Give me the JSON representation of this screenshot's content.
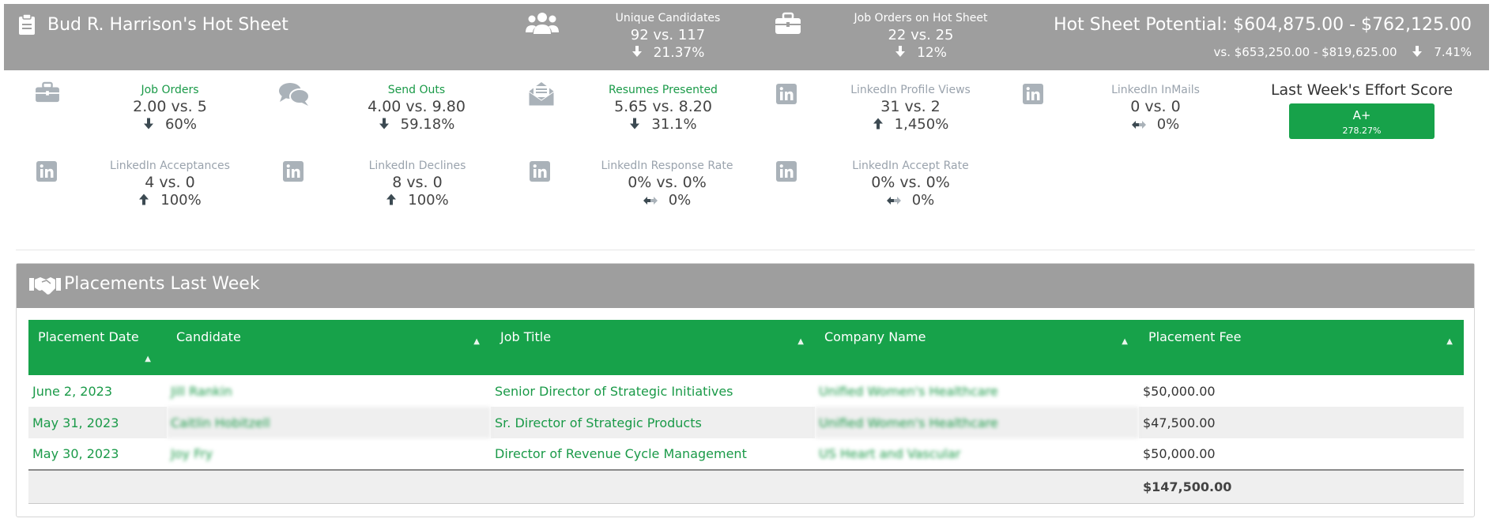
{
  "header": {
    "title": "Bud R. Harrison's Hot Sheet",
    "unique_candidates": {
      "label": "Unique Candidates",
      "value": "92 vs. 117",
      "change": "21.37%",
      "direction": "down"
    },
    "job_orders_hot": {
      "label": "Job Orders on Hot Sheet",
      "value": "22 vs. 25",
      "change": "12%",
      "direction": "down"
    },
    "potential": "Hot Sheet Potential: $604,875.00 - $762,125.00",
    "potential_compare": "vs. $653,250.00 - $819,625.00",
    "potential_change": "7.41%",
    "potential_direction": "down"
  },
  "stats": [
    {
      "label": "Job Orders",
      "value": "2.00 vs. 5",
      "change": "60%",
      "direction": "down",
      "icon": "briefcase-icon"
    },
    {
      "label": "Send Outs",
      "value": "4.00 vs. 9.80",
      "change": "59.18%",
      "direction": "down",
      "icon": "chat-bubbles-icon"
    },
    {
      "label": "Resumes Presented",
      "value": "5.65 vs. 8.20",
      "change": "31.1%",
      "direction": "down",
      "icon": "open-envelope-icon"
    },
    {
      "label": "LinkedIn Profile Views",
      "value": "31 vs. 2",
      "change": "1,450%",
      "direction": "up",
      "icon": "linkedin-icon"
    },
    {
      "label": "LinkedIn InMails",
      "value": "0 vs. 0",
      "change": "0%",
      "direction": "flat",
      "icon": "linkedin-icon"
    },
    {
      "label": "LinkedIn Acceptances",
      "value": "4 vs. 0",
      "change": "100%",
      "direction": "up",
      "icon": "linkedin-icon"
    },
    {
      "label": "LinkedIn Declines",
      "value": "8 vs. 0",
      "change": "100%",
      "direction": "up",
      "icon": "linkedin-icon"
    },
    {
      "label": "LinkedIn Response Rate",
      "value": "0% vs. 0%",
      "change": "0%",
      "direction": "flat",
      "icon": "linkedin-icon"
    },
    {
      "label": "LinkedIn Accept Rate",
      "value": "0% vs. 0%",
      "change": "0%",
      "direction": "flat",
      "icon": "linkedin-icon"
    }
  ],
  "effort": {
    "label": "Last Week's Effort Score",
    "grade": "A+",
    "percent": "278.27%"
  },
  "placements": {
    "title": "Placements Last Week",
    "columns": [
      "Placement Date",
      "Candidate",
      "Job Title",
      "Company Name",
      "Placement Fee"
    ],
    "rows": [
      {
        "date": "June 2, 2023",
        "candidate": "Jill Rankin",
        "job_title": "Senior Director of Strategic Initiatives",
        "company": "Unified Women's Healthcare",
        "fee": "$50,000.00"
      },
      {
        "date": "May 31, 2023",
        "candidate": "Caitlin Hobitzell",
        "job_title": "Sr. Director of Strategic Products",
        "company": "Unified Women's Healthcare",
        "fee": "$47,500.00"
      },
      {
        "date": "May 30, 2023",
        "candidate": "Joy Fry",
        "job_title": "Director of Revenue Cycle Management",
        "company": "US Heart and Vascular",
        "fee": "$50,000.00"
      }
    ],
    "total": "$147,500.00"
  },
  "colors": {
    "header_grey": "#9e9e9e",
    "accent_green": "#17a24a",
    "link_green": "#1a9a48",
    "muted_label": "#9aa3ad"
  }
}
